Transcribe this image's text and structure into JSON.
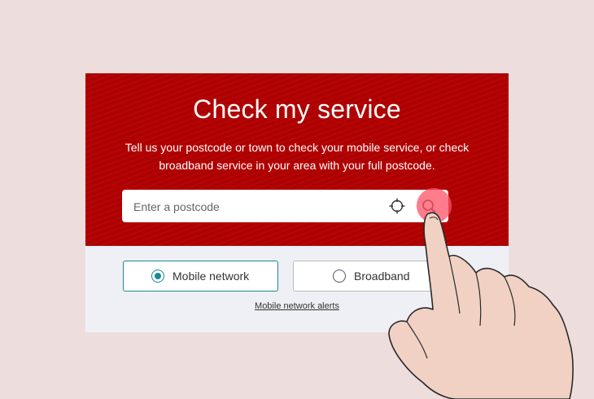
{
  "header": {
    "title": "Check my service",
    "description": "Tell us your postcode or town to check your mobile service, or check broadband service in your area with your full postcode."
  },
  "search": {
    "placeholder": "Enter a postcode",
    "value": "",
    "locate_icon": "crosshair-icon",
    "submit_icon": "search-icon"
  },
  "service_type": {
    "options": [
      {
        "label": "Mobile network",
        "selected": true
      },
      {
        "label": "Broadband",
        "selected": false
      }
    ]
  },
  "links": {
    "alerts": "Mobile network alerts"
  },
  "colors": {
    "brand_red": "#b10000",
    "accent_teal": "#1a8a96",
    "background": "#eedddd",
    "panel": "#eff0f5"
  }
}
